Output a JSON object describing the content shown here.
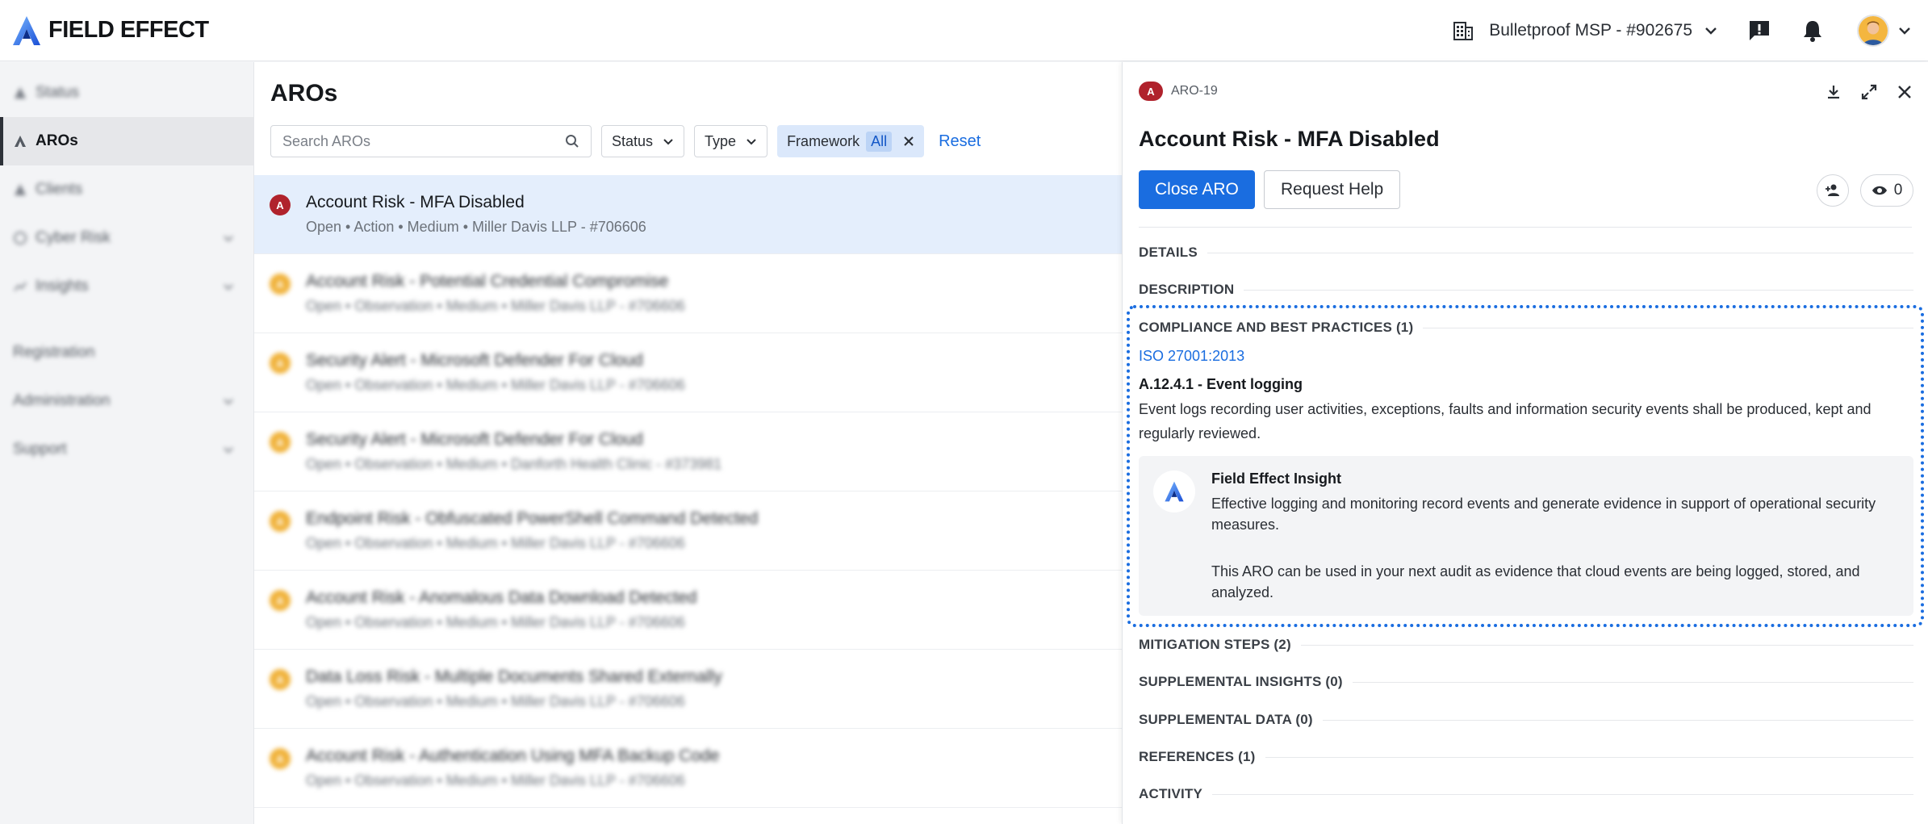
{
  "app": {
    "logo_text": "FIELD EFFECT"
  },
  "topbar": {
    "org_name": "Bulletproof MSP - #902675"
  },
  "sidebar": {
    "items": [
      {
        "label": "Status",
        "active": false
      },
      {
        "label": "AROs",
        "active": true
      },
      {
        "label": "Clients",
        "active": false
      },
      {
        "label": "Cyber Risk",
        "active": false
      },
      {
        "label": "Insights",
        "active": false
      },
      {
        "label": "Registration",
        "active": false
      },
      {
        "label": "Administration",
        "active": false
      },
      {
        "label": "Support",
        "active": false
      }
    ]
  },
  "list": {
    "title": "AROs",
    "search_placeholder": "Search AROs",
    "filter_status": "Status",
    "filter_type": "Type",
    "filter_framework": "Framework",
    "filter_framework_value": "All",
    "reset_label": "Reset",
    "rows": [
      {
        "badge": "A",
        "title": "Account Risk - MFA Disabled",
        "meta": "Open  •  Action  •  Medium  •  Miller Davis LLP - #706606"
      },
      {
        "badge": "A",
        "title": "Account Risk - Potential Credential Compromise",
        "meta": "Open  •  Observation  •  Medium  •  Miller Davis LLP - #706606"
      },
      {
        "badge": "A",
        "title": "Security Alert - Microsoft Defender For Cloud",
        "meta": "Open  •  Observation  •  Medium  •  Miller Davis LLP - #706606"
      },
      {
        "badge": "A",
        "title": "Security Alert - Microsoft Defender For Cloud",
        "meta": "Open  •  Observation  •  Medium  •  Danforth Health Clinic - #373981"
      },
      {
        "badge": "A",
        "title": "Endpoint Risk - Obfuscated PowerShell Command Detected",
        "meta": "Open  •  Observation  •  Medium  •  Miller Davis LLP - #706606"
      },
      {
        "badge": "A",
        "title": "Account Risk - Anomalous Data Download Detected",
        "meta": "Open  •  Observation  •  Medium  •  Miller Davis LLP - #706606"
      },
      {
        "badge": "A",
        "title": "Data Loss Risk - Multiple Documents Shared Externally",
        "meta": "Open  •  Observation  •  Medium  •  Miller Davis LLP - #706606"
      },
      {
        "badge": "A",
        "title": "Account Risk - Authentication Using MFA Backup Code",
        "meta": "Open  •  Observation  •  Medium  •  Miller Davis LLP - #706606"
      }
    ]
  },
  "detail": {
    "badge": "A",
    "id": "ARO-19",
    "title": "Account Risk - MFA Disabled",
    "close_label": "Close ARO",
    "help_label": "Request Help",
    "watchers": "0",
    "sections": {
      "details": "DETAILS",
      "description": "DESCRIPTION",
      "compliance": "COMPLIANCE AND BEST PRACTICES (1)",
      "mitigation": "MITIGATION STEPS (2)",
      "supp_insights": "SUPPLEMENTAL INSIGHTS (0)",
      "supp_data": "SUPPLEMENTAL DATA (0)",
      "references": "REFERENCES (1)",
      "activity": "ACTIVITY"
    },
    "framework_link": "ISO 27001:2013",
    "control_title": "A.12.4.1 - Event logging",
    "control_desc": "Event logs recording user activities, exceptions, faults and information security events shall be produced, kept and regularly reviewed.",
    "insight": {
      "title": "Field Effect Insight",
      "p1": "Effective logging and monitoring record events and generate evidence in support of operational security measures.",
      "p2": "This ARO can be used in your next audit as evidence that cloud events are being logged, stored, and analyzed."
    }
  },
  "colors": {
    "accent": "#1a6de0",
    "danger": "#b0222c",
    "warning": "#f0b23a"
  }
}
